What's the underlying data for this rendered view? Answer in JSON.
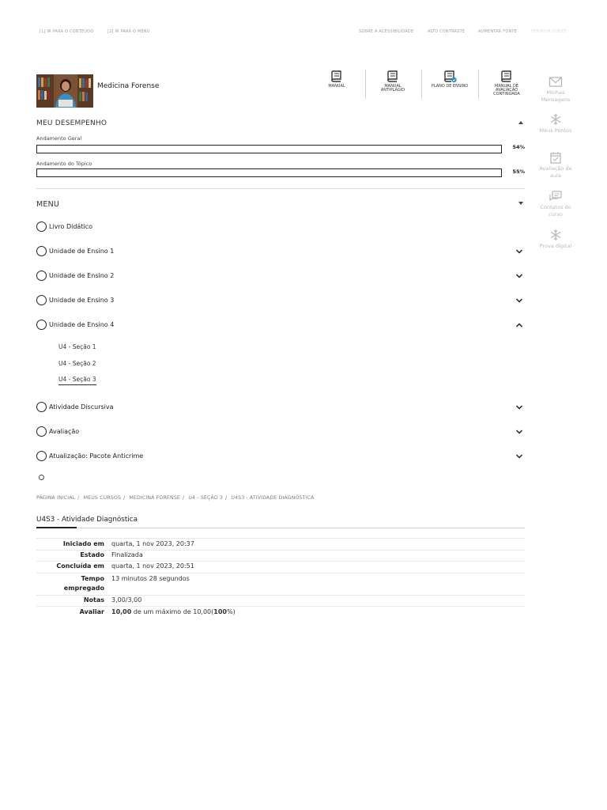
{
  "accessibility_bar": {
    "skip_content": "[1] IR PARA O CONTEÚDO",
    "skip_menu": "[2] IR PARA O MENU",
    "about_accessibility": "SOBRE A ACESSIBILIDADE",
    "high_contrast": "ALTO CONTRASTE",
    "increase_font": "AUMENTAR FONTE",
    "decrease_font": "DIMINUIR FONTE"
  },
  "course": {
    "title": "Medicina Forense"
  },
  "toolbar": [
    {
      "label": "MANUAL",
      "icon": "book-icon"
    },
    {
      "label": "MANUAL ANTIPLÁGIO",
      "icon": "book-icon"
    },
    {
      "label": "PLANO DE ENSINO",
      "icon": "book-check-icon"
    },
    {
      "label": "MANUAL DE AVALIAÇÃO CONTINUADA",
      "icon": "book-icon"
    }
  ],
  "right_rail": [
    {
      "label": "Minhas Mensagens",
      "icon": "envelope-icon"
    },
    {
      "label": "Meus Pontos",
      "icon": "snowflake-icon"
    },
    {
      "label": "Avaliação de aula",
      "icon": "calendar-check-icon"
    },
    {
      "label": "Contatos do curso",
      "icon": "chat-icon"
    },
    {
      "label": "Prova digital",
      "icon": "snowflake-icon"
    }
  ],
  "performance": {
    "title": "MEU DESEMPENHO",
    "overall_label": "Andamento Geral",
    "overall_value": "54%",
    "overall_fraction": 0.54,
    "topic_label": "Andamento do Tópico",
    "topic_value": "55%",
    "topic_fraction": 0.55
  },
  "menu": {
    "title": "MENU",
    "items": [
      {
        "label": "Livro Didático",
        "expandable": false
      },
      {
        "label": "Unidade de Ensino 1",
        "expandable": true,
        "expanded": false
      },
      {
        "label": "Unidade de Ensino 2",
        "expandable": true,
        "expanded": false
      },
      {
        "label": "Unidade de Ensino 3",
        "expandable": true,
        "expanded": false
      },
      {
        "label": "Unidade de Ensino 4",
        "expandable": true,
        "expanded": true
      },
      {
        "label": "Atividade Discursiva",
        "expandable": true,
        "expanded": false
      },
      {
        "label": "Avaliação",
        "expandable": true,
        "expanded": false
      },
      {
        "label": "Atualização: Pacote Anticrime",
        "expandable": true,
        "expanded": false
      }
    ],
    "sub_items": [
      "U4 - Seção 1",
      "U4 - Seção 2",
      "U4 - Seção 3"
    ]
  },
  "breadcrumb": [
    "PÁGINA INICIAL",
    "MEUS CURSOS",
    "MEDICINA FORENSE",
    "U4 - SEÇÃO 3",
    "U4S3 - ATIVIDADE DIAGNÓSTICA"
  ],
  "page_title": "U4S3 - Atividade Diagnóstica",
  "summary": {
    "started_label": "Iniciado em",
    "started_value": "quarta, 1 nov 2023, 20:37",
    "state_label": "Estado",
    "state_value": "Finalizada",
    "completed_label": "Concluída em",
    "completed_value": "quarta, 1 nov 2023, 20:51",
    "time_label_1": "Tempo",
    "time_label_2": "empregado",
    "time_value": "13 minutos 28 segundos",
    "marks_label": "Notas",
    "marks_value": "3,00/3,00",
    "grade_label": "Avaliar",
    "grade_score": "10,00",
    "grade_mid": " de um máximo de 10,00(",
    "grade_pct": "100",
    "grade_end": "%)"
  },
  "colors": {
    "accent": "#1e88c7",
    "rail_text": "#b4b9bd"
  }
}
